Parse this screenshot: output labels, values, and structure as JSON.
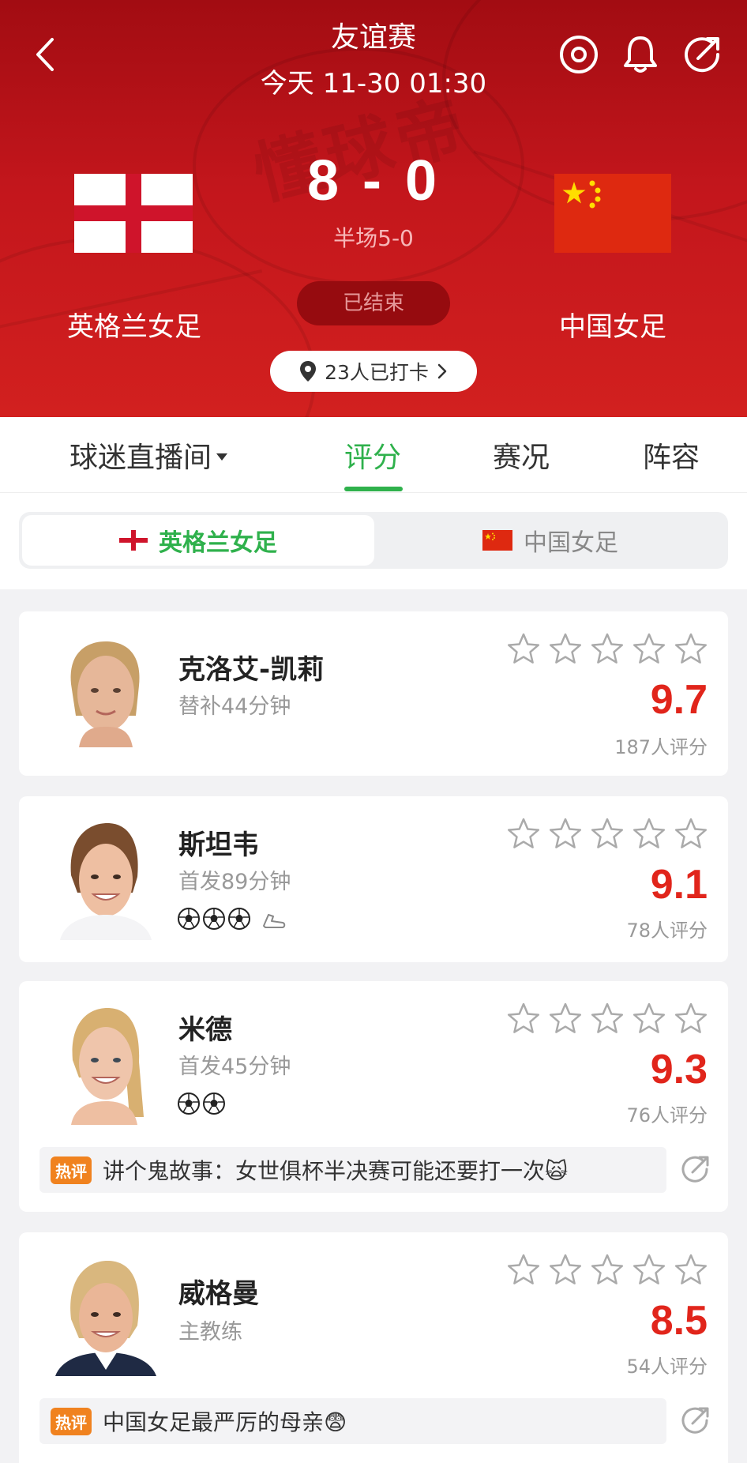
{
  "header": {
    "title": "友谊赛",
    "datetime": "今天 11-30 01:30",
    "home_team": "英格兰女足",
    "away_team": "中国女足",
    "home_score": "8",
    "score_separator": "-",
    "away_score": "0",
    "halftime": "半场5-0",
    "status": "已结束",
    "checkin": "23人已打卡",
    "watermark": "懂球帝"
  },
  "tabs": [
    {
      "label": "球迷直播间"
    },
    {
      "label": "评分"
    },
    {
      "label": "赛况"
    },
    {
      "label": "阵容"
    }
  ],
  "team_switch": {
    "active": "英格兰女足",
    "inactive": "中国女足"
  },
  "players": [
    {
      "name": "克洛艾-凯莉",
      "desc": "替补44分钟",
      "rating": "9.7",
      "count": "187人评分",
      "goals": 0,
      "assists": 0
    },
    {
      "name": "斯坦韦",
      "desc": "首发89分钟",
      "rating": "9.1",
      "count": "78人评分",
      "goals": 3,
      "assists": 1
    },
    {
      "name": "米德",
      "desc": "首发45分钟",
      "rating": "9.3",
      "count": "76人评分",
      "goals": 2,
      "assists": 0,
      "comment": {
        "badge": "热评",
        "text": "讲个鬼故事：女世俱杯半决赛可能还要打一次🙀"
      }
    },
    {
      "name": "威格曼",
      "desc": "主教练",
      "rating": "8.5",
      "count": "54人评分",
      "goals": 0,
      "assists": 0,
      "comment": {
        "badge": "热评",
        "text": "中国女足最严厉的母亲😨"
      }
    }
  ],
  "colors": {
    "header_red": "#c3161c",
    "accent_green": "#2fb14c",
    "rating_red": "#e1251b",
    "hot_orange": "#f0821f"
  },
  "icons": [
    "back-icon",
    "follow-icon",
    "bell-icon",
    "share-icon",
    "location-icon",
    "star-icon",
    "football-icon",
    "boot-icon"
  ]
}
